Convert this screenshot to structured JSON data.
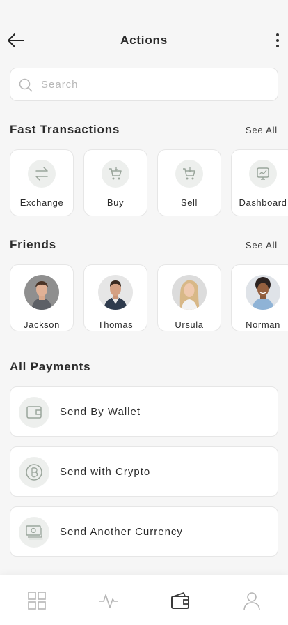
{
  "header": {
    "title": "Actions"
  },
  "search": {
    "placeholder": "Search"
  },
  "fast_transactions": {
    "title": "Fast Transactions",
    "see_all": "See All",
    "items": [
      {
        "label": "Exchange",
        "icon": "exchange-icon"
      },
      {
        "label": "Buy",
        "icon": "cart-icon"
      },
      {
        "label": "Sell",
        "icon": "cart-download-icon"
      },
      {
        "label": "Dashboard",
        "icon": "chart-monitor-icon"
      }
    ]
  },
  "friends": {
    "title": "Friends",
    "see_all": "See All",
    "items": [
      {
        "name": "Jackson"
      },
      {
        "name": "Thomas"
      },
      {
        "name": "Ursula"
      },
      {
        "name": "Norman"
      }
    ]
  },
  "payments": {
    "title": "All Payments",
    "items": [
      {
        "label": "Send By Wallet",
        "icon": "wallet-icon"
      },
      {
        "label": "Send with Crypto",
        "icon": "bitcoin-icon"
      },
      {
        "label": "Send Another Currency",
        "icon": "banknotes-icon"
      }
    ]
  },
  "bottom_nav": {
    "items": [
      {
        "icon": "grid-icon",
        "active": false
      },
      {
        "icon": "activity-icon",
        "active": false
      },
      {
        "icon": "wallet-icon",
        "active": true
      },
      {
        "icon": "profile-icon",
        "active": false
      }
    ]
  },
  "colors": {
    "icon_muted": "#9aa59b",
    "background": "#f6f6f6",
    "text": "#2b2b2b"
  }
}
